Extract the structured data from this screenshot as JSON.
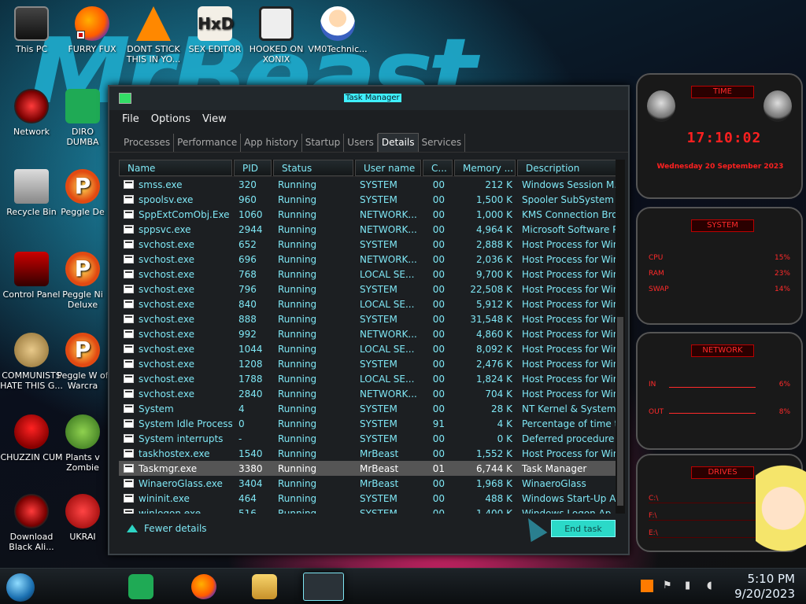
{
  "desktop": {
    "icons": [
      {
        "label": "This PC"
      },
      {
        "label": "FURRY FUX"
      },
      {
        "label": "DONT STICK THIS IN YO..."
      },
      {
        "label": "SEX EDITOR"
      },
      {
        "label": "HOOKED ON XONIX"
      },
      {
        "label": "VM0Technic..."
      },
      {
        "label": "Network"
      },
      {
        "label": "DIRO DUMBA"
      },
      {
        "label": "Recycle Bin"
      },
      {
        "label": "Peggle De"
      },
      {
        "label": "Control Panel"
      },
      {
        "label": "Peggle Ni Deluxe"
      },
      {
        "label": "COMMUNISTS HATE THIS G..."
      },
      {
        "label": "Peggle W of Warcra"
      },
      {
        "label": "CHUZZIN CUM"
      },
      {
        "label": "Plants v Zombie"
      },
      {
        "label": "Download Black Ali..."
      },
      {
        "label": "UKRAI"
      }
    ],
    "hxd_glyph": "HxD",
    "peggle_glyph": "P"
  },
  "window": {
    "title": "Task Manager",
    "menu": [
      "File",
      "Options",
      "View"
    ],
    "tabs": [
      "Processes",
      "Performance",
      "App history",
      "Startup",
      "Users",
      "Details",
      "Services"
    ],
    "active_tab": "Details",
    "columns": [
      "Name",
      "PID",
      "Status",
      "User name",
      "C...",
      "Memory ...",
      "Description"
    ],
    "rows": [
      {
        "name": "smss.exe",
        "pid": "320",
        "status": "Running",
        "user": "SYSTEM",
        "cpu": "00",
        "mem": "212 K",
        "desc": "Windows Session M..."
      },
      {
        "name": "spoolsv.exe",
        "pid": "960",
        "status": "Running",
        "user": "SYSTEM",
        "cpu": "00",
        "mem": "1,500 K",
        "desc": "Spooler SubSystem ..."
      },
      {
        "name": "SppExtComObj.Exe",
        "pid": "1060",
        "status": "Running",
        "user": "NETWORK...",
        "cpu": "00",
        "mem": "1,000 K",
        "desc": "KMS Connection Bro..."
      },
      {
        "name": "sppsvc.exe",
        "pid": "2944",
        "status": "Running",
        "user": "NETWORK...",
        "cpu": "00",
        "mem": "4,964 K",
        "desc": "Microsoft Software P..."
      },
      {
        "name": "svchost.exe",
        "pid": "652",
        "status": "Running",
        "user": "SYSTEM",
        "cpu": "00",
        "mem": "2,888 K",
        "desc": "Host Process for Win..."
      },
      {
        "name": "svchost.exe",
        "pid": "696",
        "status": "Running",
        "user": "NETWORK...",
        "cpu": "00",
        "mem": "2,036 K",
        "desc": "Host Process for Win..."
      },
      {
        "name": "svchost.exe",
        "pid": "768",
        "status": "Running",
        "user": "LOCAL SE...",
        "cpu": "00",
        "mem": "9,700 K",
        "desc": "Host Process for Win..."
      },
      {
        "name": "svchost.exe",
        "pid": "796",
        "status": "Running",
        "user": "SYSTEM",
        "cpu": "00",
        "mem": "22,508 K",
        "desc": "Host Process for Win..."
      },
      {
        "name": "svchost.exe",
        "pid": "840",
        "status": "Running",
        "user": "LOCAL SE...",
        "cpu": "00",
        "mem": "5,912 K",
        "desc": "Host Process for Win..."
      },
      {
        "name": "svchost.exe",
        "pid": "888",
        "status": "Running",
        "user": "SYSTEM",
        "cpu": "00",
        "mem": "31,548 K",
        "desc": "Host Process for Win..."
      },
      {
        "name": "svchost.exe",
        "pid": "992",
        "status": "Running",
        "user": "NETWORK...",
        "cpu": "00",
        "mem": "4,860 K",
        "desc": "Host Process for Win..."
      },
      {
        "name": "svchost.exe",
        "pid": "1044",
        "status": "Running",
        "user": "LOCAL SE...",
        "cpu": "00",
        "mem": "8,092 K",
        "desc": "Host Process for Win..."
      },
      {
        "name": "svchost.exe",
        "pid": "1208",
        "status": "Running",
        "user": "SYSTEM",
        "cpu": "00",
        "mem": "2,476 K",
        "desc": "Host Process for Win..."
      },
      {
        "name": "svchost.exe",
        "pid": "1788",
        "status": "Running",
        "user": "LOCAL SE...",
        "cpu": "00",
        "mem": "1,824 K",
        "desc": "Host Process for Win..."
      },
      {
        "name": "svchost.exe",
        "pid": "2840",
        "status": "Running",
        "user": "NETWORK...",
        "cpu": "00",
        "mem": "704 K",
        "desc": "Host Process for Win..."
      },
      {
        "name": "System",
        "pid": "4",
        "status": "Running",
        "user": "SYSTEM",
        "cpu": "00",
        "mem": "28 K",
        "desc": "NT Kernel & System"
      },
      {
        "name": "System Idle Process",
        "pid": "0",
        "status": "Running",
        "user": "SYSTEM",
        "cpu": "91",
        "mem": "4 K",
        "desc": "Percentage of time t..."
      },
      {
        "name": "System interrupts",
        "pid": "-",
        "status": "Running",
        "user": "SYSTEM",
        "cpu": "00",
        "mem": "0 K",
        "desc": "Deferred procedure ..."
      },
      {
        "name": "taskhostex.exe",
        "pid": "1540",
        "status": "Running",
        "user": "MrBeast",
        "cpu": "00",
        "mem": "1,552 K",
        "desc": "Host Process for Win..."
      },
      {
        "name": "Taskmgr.exe",
        "pid": "3380",
        "status": "Running",
        "user": "MrBeast",
        "cpu": "01",
        "mem": "6,744 K",
        "desc": "Task Manager",
        "selected": true
      },
      {
        "name": "WinaeroGlass.exe",
        "pid": "3404",
        "status": "Running",
        "user": "MrBeast",
        "cpu": "00",
        "mem": "1,968 K",
        "desc": "WinaeroGlass"
      },
      {
        "name": "wininit.exe",
        "pid": "464",
        "status": "Running",
        "user": "SYSTEM",
        "cpu": "00",
        "mem": "488 K",
        "desc": "Windows Start-Up A..."
      },
      {
        "name": "winlogon.exe",
        "pid": "516",
        "status": "Running",
        "user": "SYSTEM",
        "cpu": "00",
        "mem": "1,400 K",
        "desc": "Windows Logon Ap..."
      }
    ],
    "fewer_details": "Fewer details",
    "end_task": "End task"
  },
  "widgets": {
    "time": {
      "header": "TIME",
      "clock": "17:10:02",
      "date": "Wednesday 20 September 2023"
    },
    "system": {
      "header": "SYSTEM",
      "stats": [
        {
          "label": "CPU",
          "value": "15%"
        },
        {
          "label": "RAM",
          "value": "23%"
        },
        {
          "label": "SWAP",
          "value": "14%"
        }
      ]
    },
    "network": {
      "header": "NETWORK",
      "stats": [
        {
          "label": "IN",
          "value": "6%"
        },
        {
          "label": "OUT",
          "value": "8%"
        }
      ]
    },
    "drives": {
      "header": "DRIVES",
      "items": [
        "C:\\",
        "F:\\",
        "E:\\"
      ]
    }
  },
  "taskbar": {
    "time": "5:10 PM",
    "date": "9/20/2023"
  },
  "colors": {
    "accent": "#2bd9c8",
    "text_cyan": "#7fe7f5",
    "widget_red": "#ff2020"
  }
}
